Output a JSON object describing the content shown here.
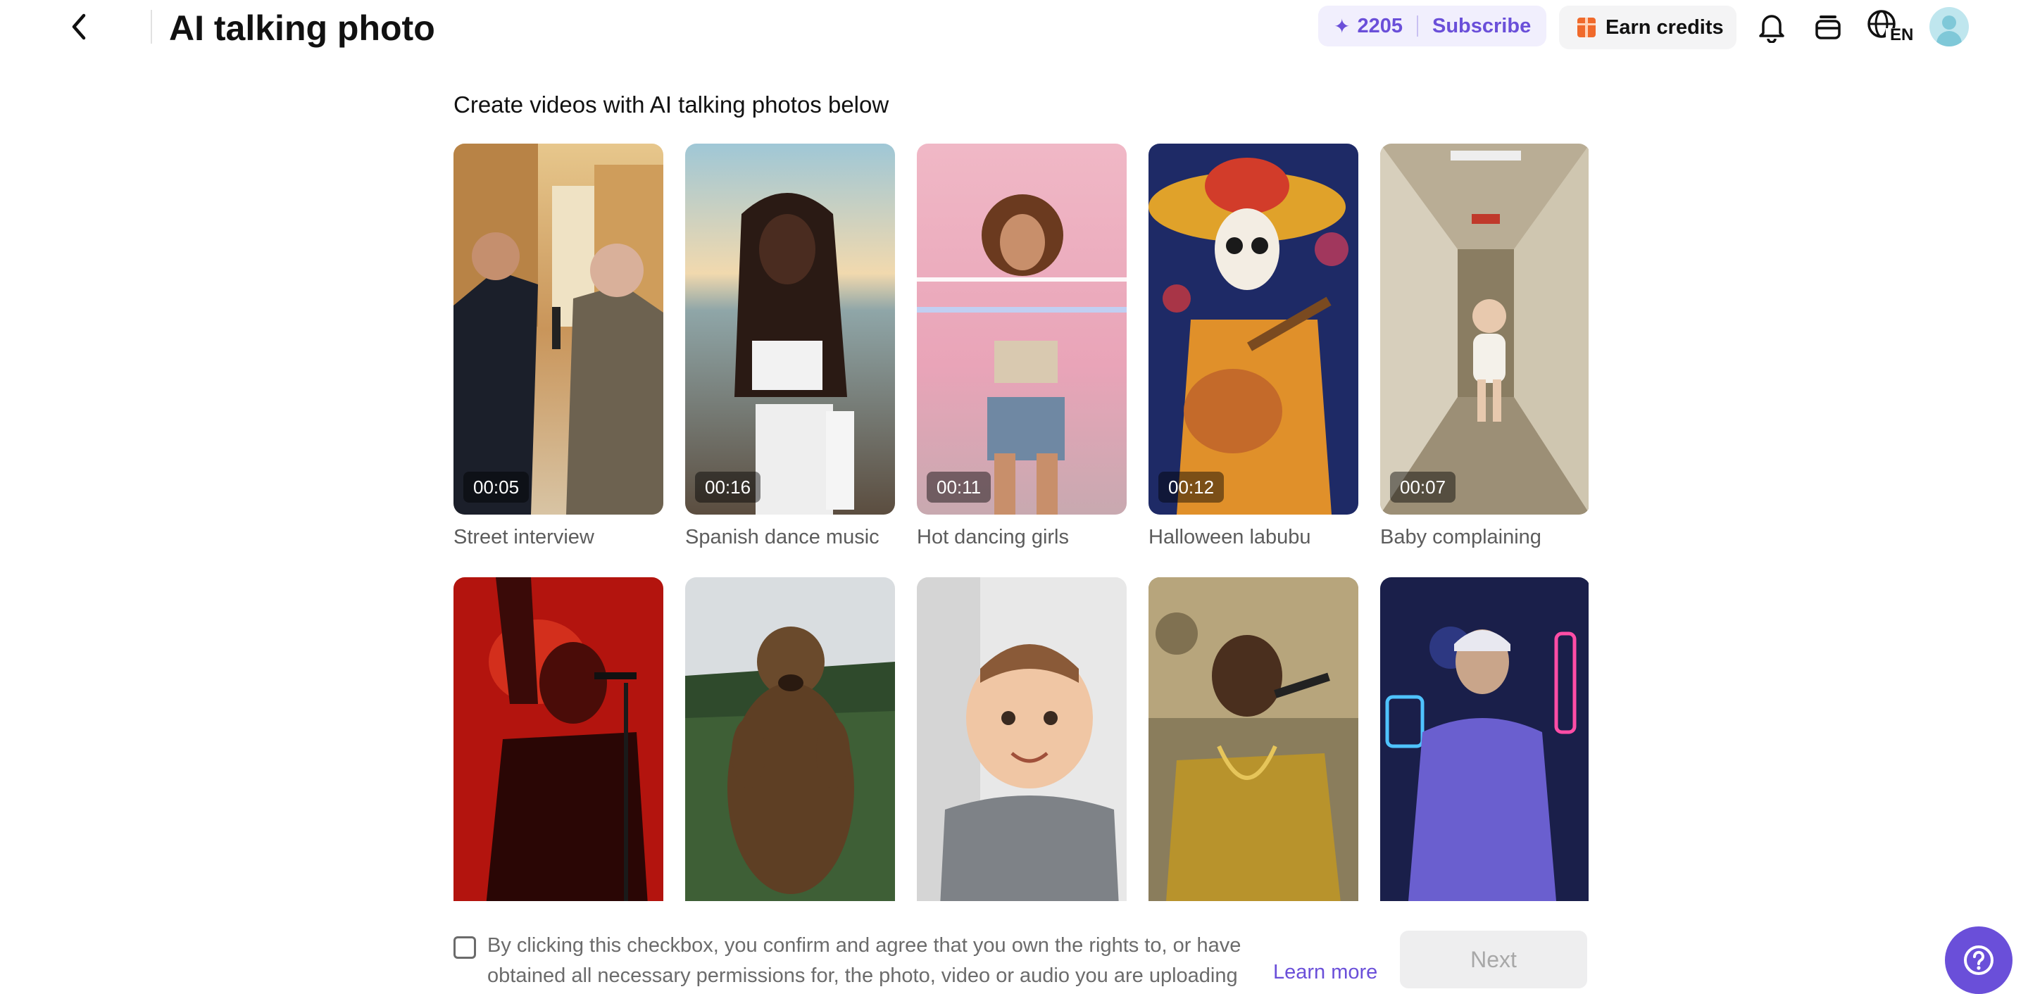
{
  "header": {
    "title": "AI talking photo",
    "credits": "2205",
    "subscribe_label": "Subscribe",
    "earn_label": "Earn credits",
    "language": "EN"
  },
  "main": {
    "subtitle": "Create videos with AI talking photos below",
    "templates": [
      {
        "label": "Street interview",
        "duration": "00:05"
      },
      {
        "label": "Spanish dance music",
        "duration": "00:16"
      },
      {
        "label": "Hot dancing girls",
        "duration": "00:11"
      },
      {
        "label": "Halloween labubu",
        "duration": "00:12"
      },
      {
        "label": "Baby complaining",
        "duration": "00:07"
      },
      {
        "label": "",
        "duration": ""
      },
      {
        "label": "",
        "duration": ""
      },
      {
        "label": "",
        "duration": ""
      },
      {
        "label": "",
        "duration": ""
      },
      {
        "label": "",
        "duration": ""
      }
    ]
  },
  "footer": {
    "consent_text": "By clicking this checkbox, you confirm and agree that you own the rights to, or have obtained all necessary permissions for, the photo, video or audio you are uploading to Pippit. Ple",
    "learn_more": "Learn more",
    "next_label": "Next"
  },
  "colors": {
    "accent": "#6a4fd9",
    "pill_bg": "#f1effd",
    "muted_text": "#6b6b6b"
  },
  "icons": [
    "back-arrow-icon",
    "sparkle-icon",
    "gift-icon",
    "bell-icon",
    "stack-icon",
    "globe-icon",
    "help-icon"
  ]
}
